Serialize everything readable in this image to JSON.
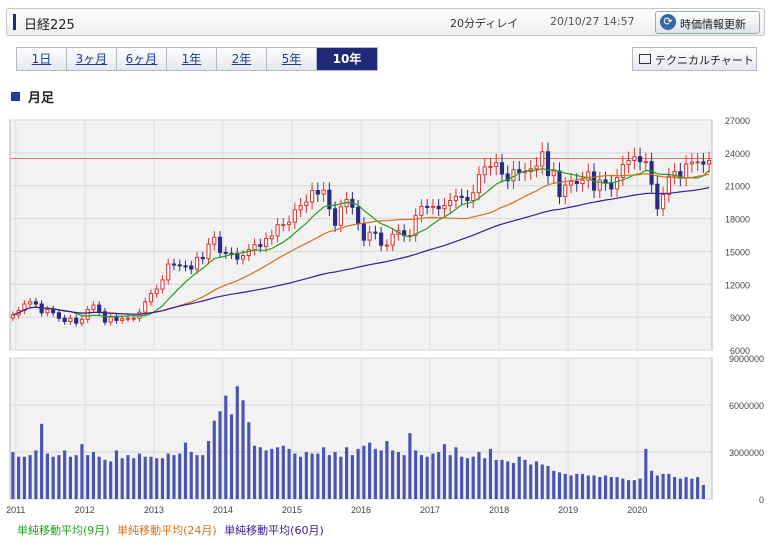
{
  "header": {
    "title": "日経225",
    "delay": "20分ディレイ",
    "timestamp": "20/10/27 14:57",
    "refresh_label": "時価情報更新"
  },
  "tabs": [
    {
      "label": "1日"
    },
    {
      "label": "3ヶ月"
    },
    {
      "label": "6ヶ月"
    },
    {
      "label": "1年"
    },
    {
      "label": "2年"
    },
    {
      "label": "5年"
    },
    {
      "label": "10年",
      "active": true
    }
  ],
  "tech_button": "テクニカルチャート",
  "section_title": "月足",
  "legend": [
    {
      "label": "単純移動平均(9月)",
      "color": "#1fa01f"
    },
    {
      "label": "単純移動平均(24月)",
      "color": "#d86f1a"
    },
    {
      "label": "単純移動平均(60月)",
      "color": "#3b1a9c"
    }
  ],
  "chart_data": [
    {
      "type": "candlestick",
      "xlabel": "",
      "ylabel": "",
      "ylim": [
        6000,
        27000
      ],
      "yticks": [
        "27000",
        "24000",
        "21000",
        "18000",
        "15000",
        "12000",
        "9000",
        "6000"
      ],
      "xticks": [
        "2011",
        "2012",
        "2013",
        "2014",
        "2015",
        "2016",
        "2017",
        "2018",
        "2019",
        "2020"
      ],
      "reference_line": 23485,
      "close": [
        9200,
        9600,
        10200,
        10400,
        10200,
        9400,
        9700,
        9400,
        8900,
        8600,
        8900,
        8450,
        8800,
        9700,
        10100,
        9500,
        8550,
        9000,
        8700,
        8850,
        8900,
        8900,
        9450,
        10400,
        11150,
        11560,
        12400,
        13850,
        13770,
        13680,
        13670,
        13390,
        14450,
        14330,
        15660,
        16290,
        14910,
        14840,
        14830,
        14300,
        14630,
        15160,
        15620,
        15460,
        16170,
        16410,
        17450,
        17450,
        17670,
        18800,
        19200,
        19520,
        20560,
        20240,
        20590,
        18890,
        17390,
        19080,
        19750,
        19030,
        17520,
        16030,
        16760,
        16670,
        15570,
        15580,
        16570,
        16890,
        16450,
        16450,
        18300,
        19110,
        19040,
        19120,
        18910,
        19200,
        19650,
        20030,
        19930,
        19650,
        20360,
        22010,
        22720,
        22760,
        23100,
        22070,
        21450,
        22460,
        22200,
        22300,
        22550,
        22800,
        24100,
        21920,
        22350,
        20010,
        21050,
        21390,
        21200,
        21510,
        22260,
        20600,
        21520,
        21280,
        20700,
        21750,
        22930,
        23300,
        23650,
        23200,
        23200,
        21140,
        18900,
        20190,
        21880,
        22290,
        21710,
        22980,
        23140,
        23180,
        22980,
        23300
      ],
      "volume": [
        3000000,
        2700000,
        2700000,
        2800000,
        3100000,
        4800000,
        2900000,
        2700000,
        2800000,
        3100000,
        2700000,
        2800000,
        3500000,
        2800000,
        3000000,
        2700000,
        2500000,
        2400000,
        3100000,
        2600000,
        2800000,
        2600000,
        2900000,
        2700000,
        2700000,
        2600000,
        2600000,
        2900000,
        2800000,
        2900000,
        3600000,
        3000000,
        2800000,
        2800000,
        3700000,
        5000000,
        5600000,
        6600000,
        5400000,
        7200000,
        6300000,
        4900000,
        3400000,
        3300000,
        3100000,
        3200000,
        3300000,
        3400000,
        3200000,
        2900000,
        2700000,
        3000000,
        2900000,
        2900000,
        3300000,
        2800000,
        3000000,
        2700000,
        3300000,
        2800000,
        3200000,
        3400000,
        3600000,
        3200000,
        3100000,
        3700000,
        3100000,
        3000000,
        2800000,
        4200000,
        3100000,
        2800000,
        2700000,
        2900000,
        3000000,
        3500000,
        2800000,
        3300000,
        2700000,
        2600000,
        2700000,
        3000000,
        2600000,
        3200000,
        2500000,
        2500000,
        2400000,
        2300000,
        2700000,
        2500000,
        2200000,
        2400000,
        2200000,
        2100000,
        1800000,
        1700000,
        1600000,
        1500000,
        1600000,
        1600000,
        1500000,
        1500000,
        1400000,
        1500000,
        1400000,
        1400000,
        1300000,
        1200000,
        1200000,
        1300000,
        3200000,
        1800000,
        1500000,
        1600000,
        1600000,
        1400000,
        1300000,
        1400000,
        1300000,
        1400000,
        900000
      ],
      "ma_series": [
        {
          "name": "単純移動平均(9月)",
          "period": 9
        },
        {
          "name": "単純移動平均(24月)",
          "period": 24
        },
        {
          "name": "単純移動平均(60月)",
          "period": 60
        }
      ]
    },
    {
      "type": "bar",
      "title": "",
      "ylim": [
        0,
        9000000
      ],
      "yticks": [
        "9000000",
        "6000000",
        "3000000",
        "0"
      ]
    }
  ]
}
